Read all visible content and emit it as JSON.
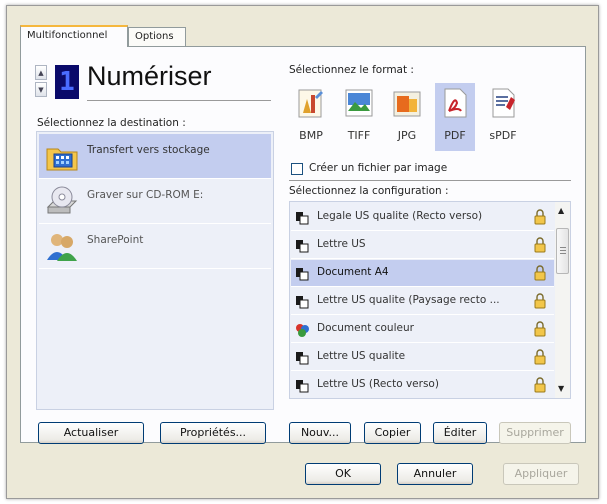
{
  "tabs": [
    {
      "label": "Multifonctionnel",
      "active": true
    },
    {
      "label": "Options",
      "active": false
    }
  ],
  "scan": {
    "digit": "1",
    "title": "Numériser"
  },
  "destination": {
    "label": "Sélectionnez la destination :",
    "items": [
      {
        "label": "Transfert vers stockage",
        "icon": "folder-transfer-icon",
        "selected": true
      },
      {
        "label": "Graver sur CD-ROM  E:",
        "icon": "cd-drive-icon",
        "selected": false
      },
      {
        "label": "SharePoint",
        "icon": "sharepoint-users-icon",
        "selected": false
      }
    ]
  },
  "format": {
    "label": "Sélectionnez le format :",
    "items": [
      {
        "label": "BMP",
        "icon": "bmp-icon",
        "selected": false
      },
      {
        "label": "TIFF",
        "icon": "tiff-icon",
        "selected": false
      },
      {
        "label": "JPG",
        "icon": "jpg-icon",
        "selected": false
      },
      {
        "label": "PDF",
        "icon": "pdf-icon",
        "selected": true
      },
      {
        "label": "sPDF",
        "icon": "spdf-icon",
        "selected": false
      }
    ],
    "one_file_label": "Créer un fichier par image",
    "one_file_checked": false
  },
  "configuration": {
    "label": "Sélectionnez la configuration :",
    "items": [
      {
        "label": "Legale US qualite (Recto verso)",
        "icon": "scanner-icon",
        "selected": false
      },
      {
        "label": "Lettre US",
        "icon": "scanner-icon",
        "selected": false
      },
      {
        "label": "Document A4",
        "icon": "scanner-icon",
        "selected": true
      },
      {
        "label": "Lettre US qualite (Paysage recto ...",
        "icon": "scanner-icon",
        "selected": false
      },
      {
        "label": "Document couleur",
        "icon": "color-document-icon",
        "selected": false
      },
      {
        "label": "Lettre US qualite",
        "icon": "scanner-icon",
        "selected": false
      },
      {
        "label": "Lettre US (Recto verso)",
        "icon": "scanner-icon",
        "selected": false
      }
    ]
  },
  "buttons": {
    "refresh": "Actualiser",
    "properties": "Propriétés...",
    "new": "Nouv...",
    "copy": "Copier",
    "edit": "Éditer",
    "delete": "Supprimer",
    "ok": "OK",
    "cancel": "Annuler",
    "apply": "Appliquer"
  },
  "colors": {
    "selection": "#c3cdef",
    "list_background": "#edf0f8",
    "dialog_background": "#ece9d8",
    "digit_background": "#0a0a6a",
    "digit_color": "#4a6cff"
  }
}
